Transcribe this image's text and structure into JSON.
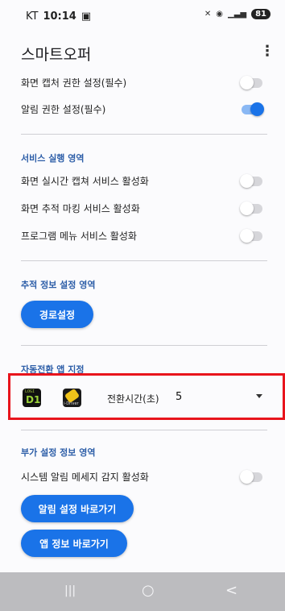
{
  "status_bar": {
    "carrier": "KT",
    "time": "10:14",
    "battery": "81"
  },
  "app": {
    "title": "스마트오퍼",
    "more_icon": "⋮"
  },
  "permissions": {
    "items": [
      {
        "label": "화면 캡처 권한 설정(필수)",
        "on": false
      },
      {
        "label": "알림 권한 설정(필수)",
        "on": true
      }
    ]
  },
  "service": {
    "heading": "서비스 실행 영역",
    "items": [
      {
        "label": "화면 실시간 캡쳐 서비스 활성화",
        "on": false
      },
      {
        "label": "화면 추적 마킹 서비스 활성화",
        "on": false
      },
      {
        "label": "프로그램 메뉴 서비스 활성화",
        "on": false
      }
    ]
  },
  "tracking": {
    "heading": "추적 정보 설정 영역",
    "route_button": "경로설정"
  },
  "auto_switch": {
    "heading": "자동전환 앱 지정",
    "switch_label": "전환시간(초)",
    "switch_value": "5",
    "icons": [
      "d1-app-icon",
      "idriver-app-icon"
    ]
  },
  "extra": {
    "heading": "부가 설정 정보 영역",
    "items": [
      {
        "label": "시스템 알림 메세지 감지 활성화",
        "on": false
      }
    ],
    "notification_button": "알림 설정 바로가기",
    "app_info_button": "앱 정보 바로가기"
  },
  "nav": {
    "recents": "|||",
    "home": "○",
    "back": "<"
  },
  "colors": {
    "accent": "#1a73e8",
    "section_heading": "#2d5ea8",
    "highlight": "#e8141c"
  }
}
